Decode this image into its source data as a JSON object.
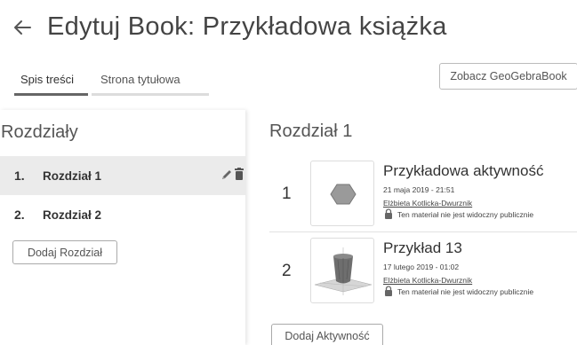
{
  "header": {
    "title": "Edytuj Book: Przykładowa książka",
    "back_icon": "arrow-left-icon"
  },
  "tabs": [
    {
      "label": "Spis treści",
      "active": true
    },
    {
      "label": "Strona tytułowa",
      "active": false
    }
  ],
  "toolbar": {
    "view_book_label": "Zobacz GeoGebraBook"
  },
  "chapters_panel": {
    "heading": "Rozdziały",
    "items": [
      {
        "number": "1.",
        "label": "Rozdział 1",
        "active": true
      },
      {
        "number": "2.",
        "label": "Rozdział 2",
        "active": false
      }
    ],
    "add_label": "Dodaj Rozdział",
    "edit_icon": "pencil-icon",
    "delete_icon": "trash-icon"
  },
  "chapter": {
    "heading": "Rozdział 1",
    "activities": [
      {
        "number": "1",
        "title": "Przykładowa aktywność",
        "date": "21 maja 2019 - 21:51",
        "author": "Elżbieta Kotlicka-Dwurznik",
        "visibility": "Ten materiał nie jest widoczny publicznie",
        "thumbnail_icon": "hexagon-thumbnail"
      },
      {
        "number": "2",
        "title": "Przykład 13",
        "date": "17 lutego 2019 - 01:02",
        "author": "Elżbieta Kotlicka-Dwurznik",
        "visibility": "Ten materiał nie jest widoczny publicznie",
        "thumbnail_icon": "3d-plot-thumbnail"
      }
    ],
    "add_activity_label": "Dodaj Aktywność"
  },
  "colors": {
    "active_row_bg": "#ebebeb",
    "active_tab_underline": "#666666",
    "inactive_tab_underline": "#dcdcdc"
  }
}
